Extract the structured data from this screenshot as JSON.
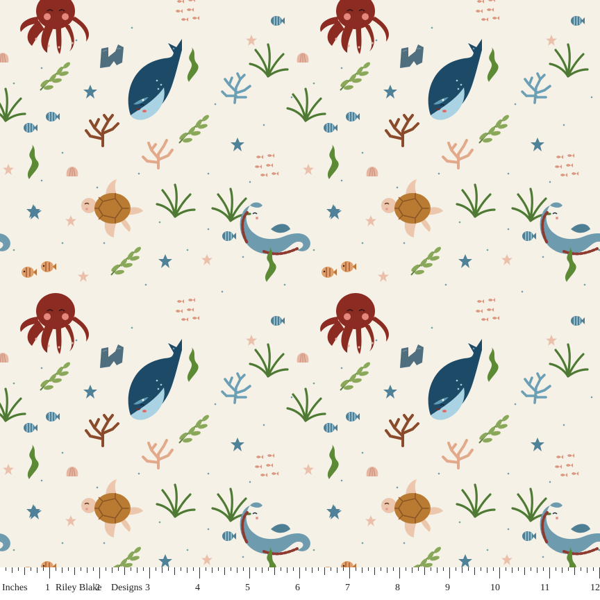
{
  "ruler": {
    "unit_label": "Inches",
    "brand": "Riley Blake",
    "designs": "Designs",
    "numbers": [
      "1",
      "2",
      "3",
      "4",
      "5",
      "6",
      "7",
      "8",
      "9",
      "10",
      "11",
      "12"
    ]
  },
  "colors": {
    "background": "#f6f1e7",
    "octopus": "#8b2b22",
    "whale": "#1d4a66",
    "whale_belly": "#a9d3e3",
    "turtle_shell": "#b97a32",
    "turtle_skin": "#ecc7ad",
    "jellyfish": "#efd2bd",
    "seahorse": "#6e9cae",
    "seaweed_green": "#4e7a34",
    "coral_brown": "#8a4b2c",
    "coral_peach": "#e2a98a",
    "coral_blue": "#6b9fb5",
    "starfish": "#4f8199"
  },
  "motifs": [
    "octopus-icon",
    "whale-icon",
    "turtle-icon",
    "jellyfish-icon",
    "seahorse-icon",
    "seaweed-icon",
    "coral-icon",
    "starfish-icon",
    "fish-icon",
    "rock-icon"
  ]
}
